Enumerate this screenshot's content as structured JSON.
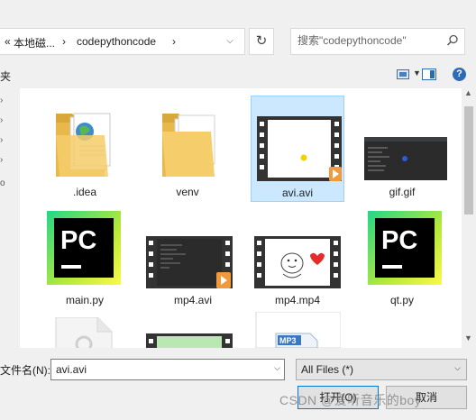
{
  "address_bar": {
    "crumb_prefix": "«",
    "crumb_parent": "本地磁...",
    "crumb_sep1": "›",
    "crumb_current": "codepythoncode",
    "crumb_sep2": "›",
    "dropdown_icon": "chevron-down-icon",
    "refresh_icon": "refresh-icon",
    "search_placeholder": "搜索\"codepythoncode\"",
    "search_icon": "search-icon"
  },
  "toolbar": {
    "left_partial_label": "夹",
    "view_icon": "view-mode-icon",
    "preview_pane_icon": "preview-pane-icon",
    "help_label": "?"
  },
  "files": [
    {
      "name": ".idea",
      "type": "folder-docs"
    },
    {
      "name": "venv",
      "type": "folder"
    },
    {
      "name": "avi.avi",
      "type": "video",
      "selected": true
    },
    {
      "name": "gif.gif",
      "type": "image-dark"
    },
    {
      "name": "main.py",
      "type": "pycharm"
    },
    {
      "name": "mp4.avi",
      "type": "video-dark"
    },
    {
      "name": "mp4.mp4",
      "type": "video-cartoon"
    },
    {
      "name": "qt.py",
      "type": "pycharm"
    },
    {
      "name": "",
      "type": "doc-gear"
    },
    {
      "name": "",
      "type": "video-green"
    },
    {
      "name": "",
      "type": "mp3"
    }
  ],
  "bottom": {
    "filename_label": "文件名(N):",
    "filename_value": "avi.avi",
    "filetype_value": "All Files  (*)",
    "open_label": "打开(O)",
    "cancel_label": "取消",
    "watermark": "CSDN @爱听音乐的boy"
  },
  "colors": {
    "selection_bg": "#cce8ff",
    "selection_border": "#99d1ff",
    "folder": "#f2c35a",
    "pycharm_green": "#21d789",
    "pycharm_yellow": "#fcf84a"
  }
}
